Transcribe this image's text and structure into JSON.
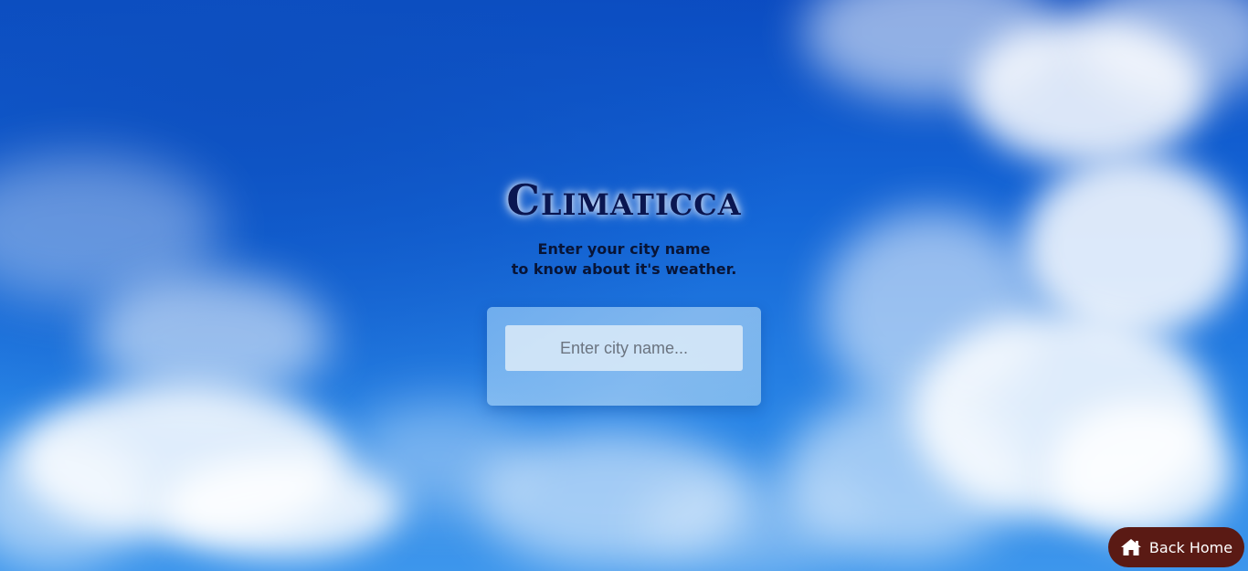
{
  "app": {
    "title": "Climaticca",
    "subtitle_line1": "Enter your city name",
    "subtitle_line2": "to know about it's weather."
  },
  "search": {
    "placeholder": "Enter city name...",
    "value": ""
  },
  "nav": {
    "back_home_label": "Back Home",
    "back_home_icon": "home-icon"
  },
  "colors": {
    "brand_text": "#0a1650",
    "back_home_bg": "#5a1a14",
    "sky": "#1568d8"
  }
}
